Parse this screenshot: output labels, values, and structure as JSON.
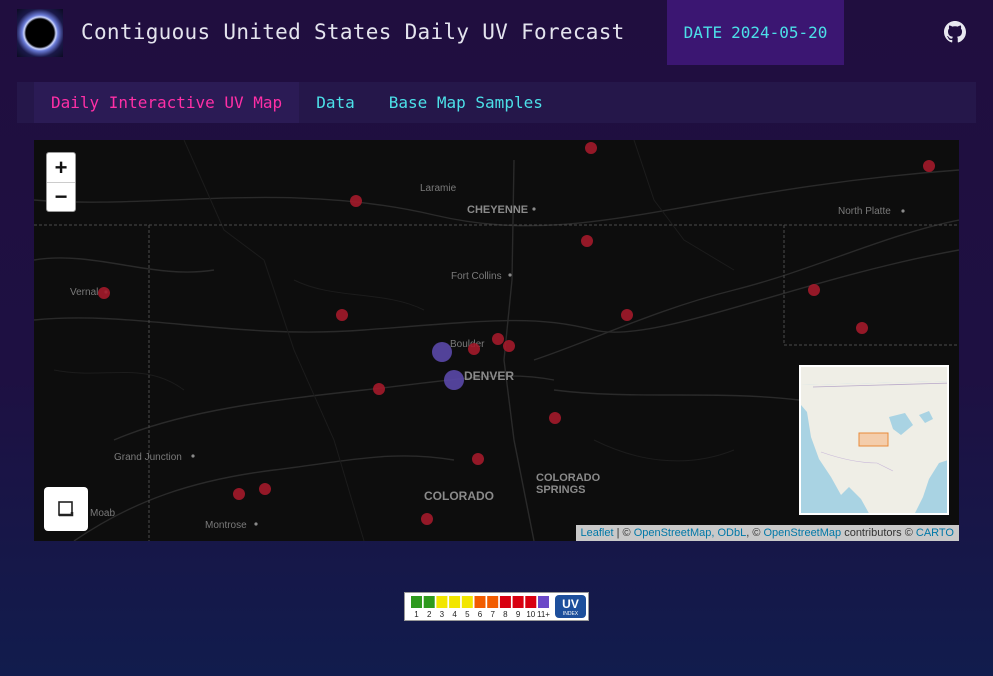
{
  "header": {
    "title": "Contiguous United States Daily UV Forecast",
    "date_label": "DATE",
    "date_value": "2024-05-20",
    "logo_icon": "eclipse-logo-icon",
    "github_icon": "github-icon"
  },
  "nav": {
    "tabs": [
      {
        "label": "Daily Interactive UV Map",
        "active": true
      },
      {
        "label": "Data",
        "active": false
      },
      {
        "label": "Base Map Samples",
        "active": false
      }
    ]
  },
  "map": {
    "zoom_in_label": "+",
    "zoom_out_label": "−",
    "fullscreen_icon": "fullscreen-icon",
    "places": {
      "laramie": "Laramie",
      "cheyenne": "CHEYENNE",
      "north_platte": "North Platte",
      "fort_collins": "Fort Collins",
      "vernal": "Vernal",
      "boulder": "Boulder",
      "denver": "DENVER",
      "grand_junction": "Grand Junction",
      "colorado_springs_1": "COLORADO",
      "colorado_springs_2": "SPRINGS",
      "colorado": "COLORADO",
      "moab": "Moab",
      "montrose": "Montrose"
    },
    "marker_colors": {
      "very_high": "#a3192a",
      "extreme": "#5a48a8"
    },
    "attribution": {
      "leaflet": "Leaflet",
      "sep": " | © ",
      "osm_odbl": "OpenStreetMap, ODbL",
      "mid": ", © ",
      "osm": "OpenStreetMap",
      "contrib": " contributors © ",
      "carto": "CARTO"
    }
  },
  "uv_legend": {
    "numbers": [
      "1",
      "2",
      "3",
      "4",
      "5",
      "6",
      "7",
      "8",
      "9",
      "10",
      "11+"
    ],
    "colors": [
      "#2e9a1e",
      "#2e9a1e",
      "#f2e600",
      "#f2e600",
      "#f2e600",
      "#f25c00",
      "#f25c00",
      "#d80010",
      "#d80010",
      "#d80010",
      "#6b49c8"
    ],
    "badge_top": "UV",
    "badge_bottom": "INDEX"
  }
}
